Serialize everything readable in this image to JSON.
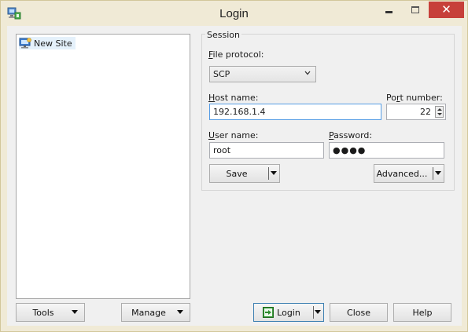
{
  "window": {
    "title": "Login"
  },
  "titlebar": {
    "minimize": "minimize",
    "maximize": "maximize",
    "close_glyph": "✕"
  },
  "sites": {
    "items": [
      {
        "label": "New Site",
        "icon": "computer-icon"
      }
    ]
  },
  "left_buttons": {
    "tools": "Tools",
    "manage": "Manage"
  },
  "session": {
    "group_label": "Session",
    "file_protocol": {
      "label_accel": "F",
      "label_rest": "ile protocol:",
      "value": "SCP"
    },
    "host": {
      "label_accel": "H",
      "label_rest": "ost name:",
      "value": "192.168.1.4"
    },
    "port": {
      "label_pre": "Po",
      "label_accel": "r",
      "label_rest": "t number:",
      "value": "22"
    },
    "user": {
      "label_accel": "U",
      "label_rest": "ser name:",
      "value": "root"
    },
    "password": {
      "label_accel": "P",
      "label_rest": "assword:",
      "value_masked": "●●●●"
    },
    "save_button": "Save",
    "advanced_button": "Advanced..."
  },
  "bottom_buttons": {
    "login": "Login",
    "close": "Close",
    "help": "Help"
  },
  "colors": {
    "frame": "#f0ead6",
    "close_button": "#c7403a",
    "focus_border": "#569de5",
    "login_icon": "#3a9a3a"
  }
}
